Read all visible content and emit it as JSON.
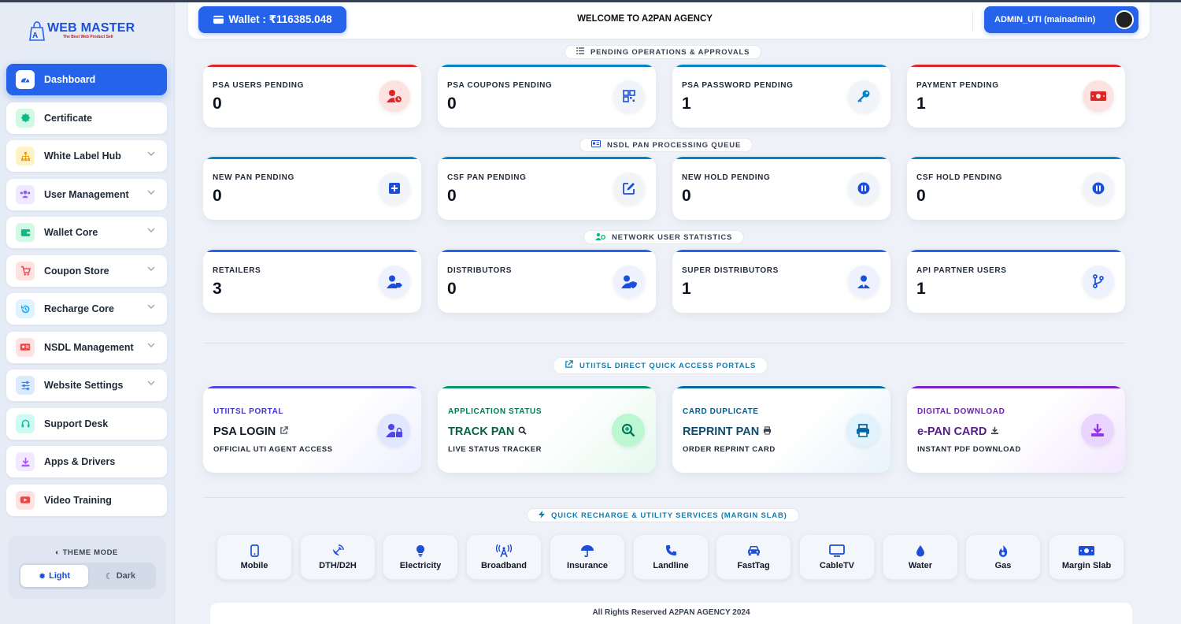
{
  "brand": {
    "name": "WEB MASTER",
    "tagline": "The Best Web Product Sell"
  },
  "sidebar": {
    "items": [
      {
        "label": "Dashboard",
        "icon": "dashboard-icon",
        "color": "#2563eb"
      },
      {
        "label": "Certificate",
        "icon": "badge-icon",
        "color": "#10b981"
      },
      {
        "label": "White Label Hub",
        "icon": "sitemap-icon",
        "color": "#f59e0b"
      },
      {
        "label": "User Management",
        "icon": "users-icon",
        "color": "#8b5cf6"
      },
      {
        "label": "Wallet Core",
        "icon": "wallet-icon",
        "color": "#10b981"
      },
      {
        "label": "Coupon Store",
        "icon": "cart-icon",
        "color": "#ef4444"
      },
      {
        "label": "Recharge Core",
        "icon": "history-icon",
        "color": "#0ea5e9"
      },
      {
        "label": "NSDL Management",
        "icon": "id-card-icon",
        "color": "#ef4444"
      },
      {
        "label": "Website Settings",
        "icon": "sliders-icon",
        "color": "#3b82f6"
      },
      {
        "label": "Support Desk",
        "icon": "headset-icon",
        "color": "#14b8a6"
      },
      {
        "label": "Apps & Drivers",
        "icon": "download-icon",
        "color": "#a855f7"
      },
      {
        "label": "Video Training",
        "icon": "youtube-icon",
        "color": "#ef4444"
      }
    ]
  },
  "theme": {
    "title": "THEME MODE",
    "light": "Light",
    "dark": "Dark"
  },
  "header": {
    "wallet": "Wallet : ₹116385.048",
    "welcome": "WELCOME TO A2PAN AGENCY",
    "admin": "ADMIN_UTI (mainadmin)"
  },
  "sections": {
    "pending": "PENDING OPERATIONS & APPROVALS",
    "nsdl": "NSDL PAN PROCESSING QUEUE",
    "network": "NETWORK USER STATISTICS",
    "portals": "UTIITSL DIRECT QUICK ACCESS PORTALS",
    "services": "QUICK RECHARGE & UTILITY SERVICES (MARGIN SLAB)"
  },
  "pending_cards": [
    {
      "title": "PSA USERS PENDING",
      "value": "0",
      "icon": "user-clock-icon",
      "color": "#dc2626"
    },
    {
      "title": "PSA COUPONS PENDING",
      "value": "0",
      "icon": "qrcode-icon",
      "color": "#0284c7"
    },
    {
      "title": "PSA PASSWORD PENDING",
      "value": "1",
      "icon": "key-icon",
      "color": "#0284c7"
    },
    {
      "title": "PAYMENT PENDING",
      "value": "1",
      "icon": "money-icon",
      "color": "#dc2626"
    }
  ],
  "nsdl_cards": [
    {
      "title": "NEW PAN PENDING",
      "value": "0",
      "icon": "plus-square-icon",
      "color": "#0284c7"
    },
    {
      "title": "CSF PAN PENDING",
      "value": "0",
      "icon": "edit-icon",
      "color": "#0284c7"
    },
    {
      "title": "NEW HOLD PENDING",
      "value": "0",
      "icon": "pause-icon",
      "color": "#0284c7"
    },
    {
      "title": "CSF HOLD PENDING",
      "value": "0",
      "icon": "pause-icon",
      "color": "#0284c7"
    }
  ],
  "network_cards": [
    {
      "title": "RETAILERS",
      "value": "3",
      "icon": "user-tag-icon",
      "color": "#2563eb"
    },
    {
      "title": "DISTRIBUTORS",
      "value": "0",
      "icon": "user-shield-icon",
      "color": "#2563eb"
    },
    {
      "title": "SUPER DISTRIBUTORS",
      "value": "1",
      "icon": "user-tie-icon",
      "color": "#2563eb"
    },
    {
      "title": "API PARTNER USERS",
      "value": "1",
      "icon": "code-branch-icon",
      "color": "#2563eb"
    }
  ],
  "portals": [
    {
      "over": "UTIITSL PORTAL",
      "main": "PSA LOGIN",
      "sub": "OFFICIAL UTI AGENT ACCESS",
      "main_icon": "external-link-icon",
      "icon": "user-lock-icon",
      "color": "#4f46e5"
    },
    {
      "over": "APPLICATION STATUS",
      "main": "TRACK PAN",
      "sub": "LIVE STATUS TRACKER",
      "main_icon": "search-icon",
      "icon": "search-plus-icon",
      "color": "#059669"
    },
    {
      "over": "CARD DUPLICATE",
      "main": "REPRINT PAN",
      "sub": "ORDER REPRINT CARD",
      "main_icon": "print-icon",
      "icon": "printer-icon",
      "color": "#0369a1"
    },
    {
      "over": "DIGITAL DOWNLOAD",
      "main": "e-PAN CARD",
      "sub": "INSTANT PDF DOWNLOAD",
      "main_icon": "download-icon",
      "icon": "file-download-icon",
      "color": "#7e22ce"
    }
  ],
  "services": [
    {
      "label": "Mobile",
      "icon": "mobile-icon"
    },
    {
      "label": "DTH/D2H",
      "icon": "satellite-dish-icon"
    },
    {
      "label": "Electricity",
      "icon": "lightbulb-icon"
    },
    {
      "label": "Broadband",
      "icon": "broadcast-tower-icon"
    },
    {
      "label": "Insurance",
      "icon": "umbrella-icon"
    },
    {
      "label": "Landline",
      "icon": "phone-icon"
    },
    {
      "label": "FastTag",
      "icon": "car-icon"
    },
    {
      "label": "CableTV",
      "icon": "tv-icon"
    },
    {
      "label": "Water",
      "icon": "droplet-icon"
    },
    {
      "label": "Gas",
      "icon": "fire-icon"
    },
    {
      "label": "Margin Slab",
      "icon": "money-bill-icon"
    }
  ],
  "footer": "All Rights Reserved A2PAN AGENCY 2024"
}
